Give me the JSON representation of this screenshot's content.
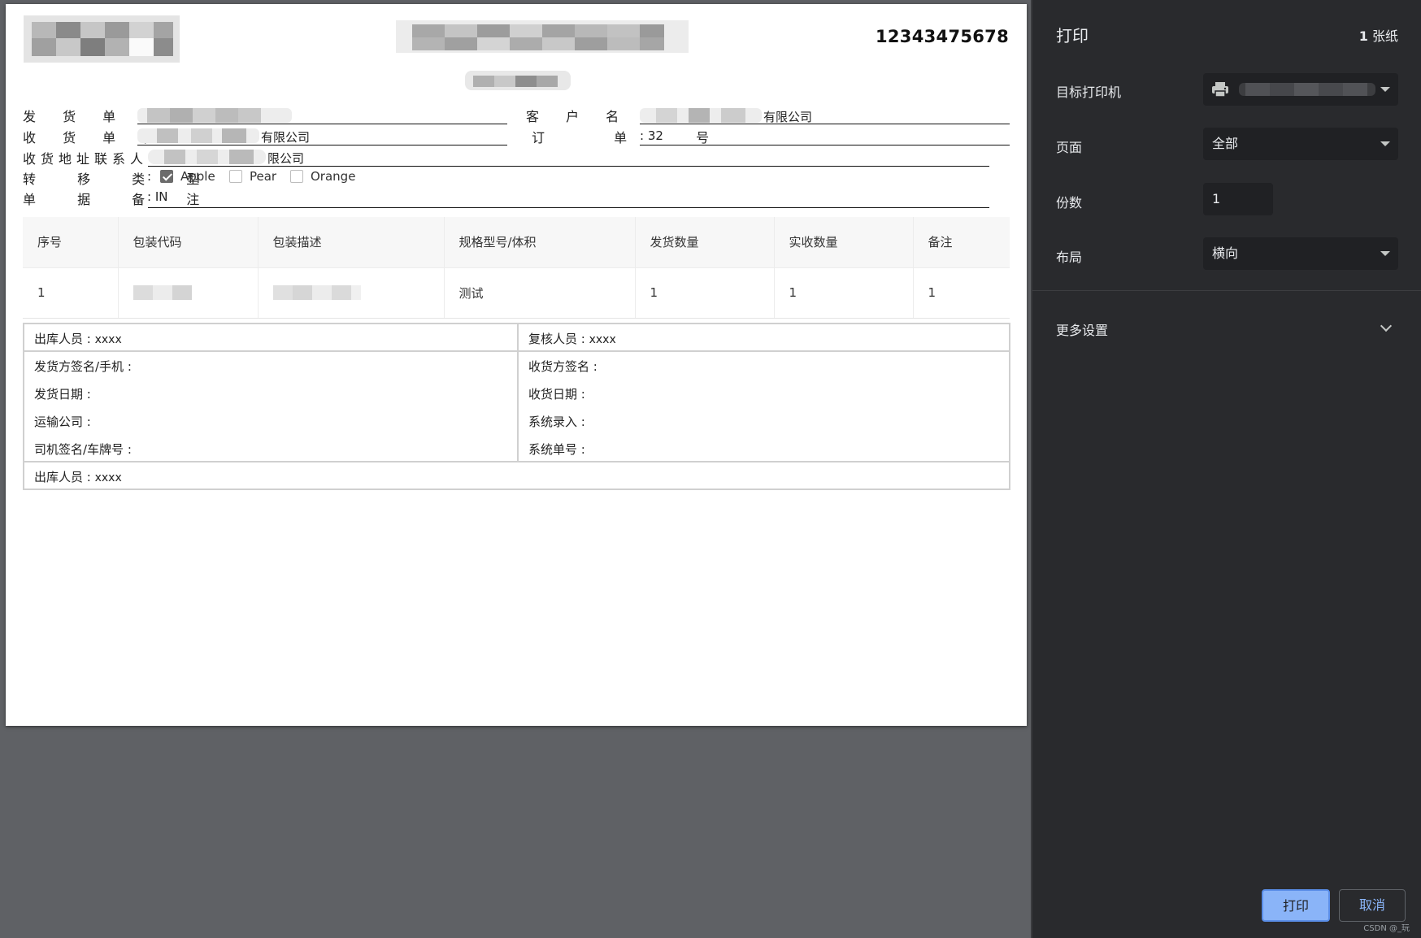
{
  "document": {
    "number": "12343475678",
    "fields": {
      "shipper_label": "发 货 单 位",
      "customer_label": "客 户 名 称",
      "customer_value": "有限公司",
      "receiver_label": "收 货 单 位",
      "receiver_value": "有限公司",
      "order_label": "订 单 号",
      "order_value": ": 32",
      "contact_label": "收货地址联系人",
      "contact_value": "限公司",
      "transfer_label": "转 移 类 型",
      "remark_label": "单 据 备 注",
      "remark_value": ": IN"
    },
    "transfer_options": [
      {
        "label": "Apple",
        "checked": true
      },
      {
        "label": "Pear",
        "checked": false
      },
      {
        "label": "Orange",
        "checked": false
      }
    ],
    "table": {
      "headers": [
        "序号",
        "包装代码",
        "包装描述",
        "规格型号/体积",
        "发货数量",
        "实收数量",
        "备注"
      ],
      "rows": [
        [
          "1",
          "",
          "",
          "测试",
          "1",
          "1",
          "1"
        ]
      ]
    },
    "signature": {
      "outbound_staff": "出库人员",
      "outbound_value": "xxxx",
      "reviewer": "复核人员",
      "reviewer_value": "xxxx",
      "shipper_sign": "发货方签名/手机 :",
      "receiver_sign": "收货方签名 :",
      "ship_date": "发货日期 :",
      "receive_date": "收货日期 :",
      "transport_company": "运输公司 :",
      "system_entry": "系统录入 :",
      "driver_sign": "司机签名/车牌号 :",
      "system_number": "系统单号 :",
      "outbound_staff_2": "出库人员",
      "outbound_value_2": "xxxx"
    }
  },
  "panel": {
    "title": "打印",
    "sheet_count_num": "1",
    "sheet_count_unit": "张纸",
    "printer_label": "目标打印机",
    "printer_icon": "printer-icon",
    "pages_label": "页面",
    "pages_value": "全部",
    "copies_label": "份数",
    "copies_value": "1",
    "layout_label": "布局",
    "layout_value": "横向",
    "more_settings": "更多设置",
    "print_button": "打印",
    "cancel_button": "取消",
    "watermark": "CSDN @_玩",
    "accent": "#8ab4f8",
    "background": "#292a2d"
  }
}
